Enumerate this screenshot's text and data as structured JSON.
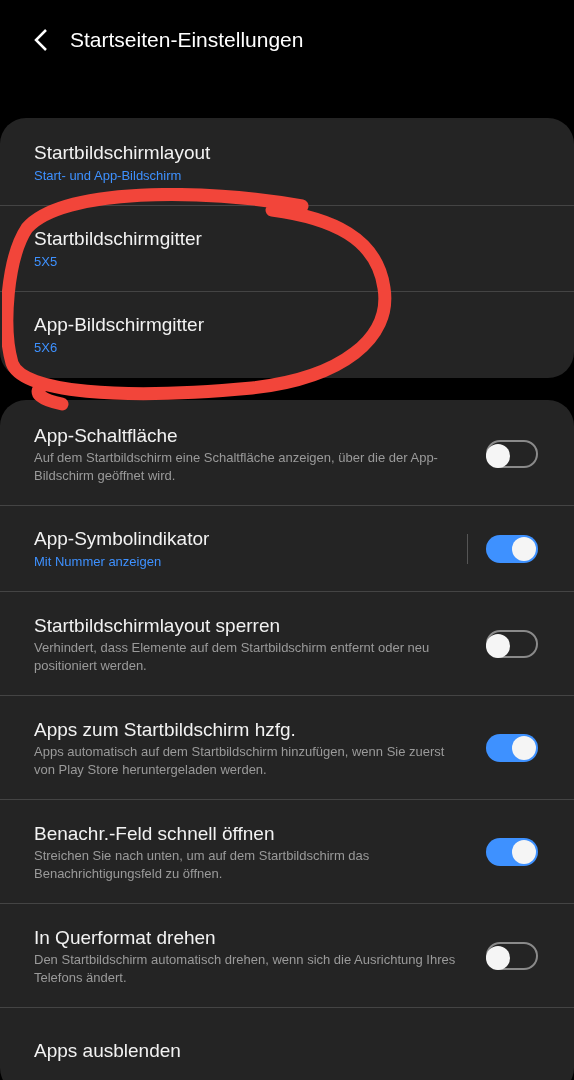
{
  "header": {
    "title": "Startseiten-Einstellungen"
  },
  "groups": [
    {
      "items": [
        {
          "title": "Startbildschirmlayout",
          "subtitle": "Start- und App-Bildschirm",
          "accent": true,
          "kind": "link"
        },
        {
          "title": "Startbildschirmgitter",
          "subtitle": "5X5",
          "accent": true,
          "kind": "link"
        },
        {
          "title": "App-Bildschirmgitter",
          "subtitle": "5X6",
          "accent": true,
          "kind": "link"
        }
      ]
    },
    {
      "items": [
        {
          "title": "App-Schaltfläche",
          "subtitle": "Auf dem Startbildschirm eine Schaltfläche anzeigen, über die der App-Bildschirm geöffnet wird.",
          "accent": false,
          "kind": "switch",
          "on": false
        },
        {
          "title": "App-Symbolindikator",
          "subtitle": "Mit Nummer anzeigen",
          "accent": true,
          "kind": "switch",
          "on": true,
          "split": true
        },
        {
          "title": "Startbildschirmlayout sperren",
          "subtitle": "Verhindert, dass Elemente auf dem Startbildschirm entfernt oder neu positioniert werden.",
          "accent": false,
          "kind": "switch",
          "on": false
        },
        {
          "title": "Apps zum Startbildschirm hzfg.",
          "subtitle": "Apps automatisch auf dem Startbildschirm hinzufügen, wenn Sie zuerst von Play Store heruntergeladen werden.",
          "accent": false,
          "kind": "switch",
          "on": true
        },
        {
          "title": "Benachr.-Feld schnell öffnen",
          "subtitle": "Streichen Sie nach unten, um auf dem Startbildschirm das Benachrichtigungsfeld zu öffnen.",
          "accent": false,
          "kind": "switch",
          "on": true
        },
        {
          "title": "In Querformat drehen",
          "subtitle": "Den Startbildschirm automatisch drehen, wenn sich die Ausrichtung Ihres Telefons ändert.",
          "accent": false,
          "kind": "switch",
          "on": false
        },
        {
          "title": "Apps ausblenden",
          "kind": "link"
        }
      ]
    }
  ]
}
